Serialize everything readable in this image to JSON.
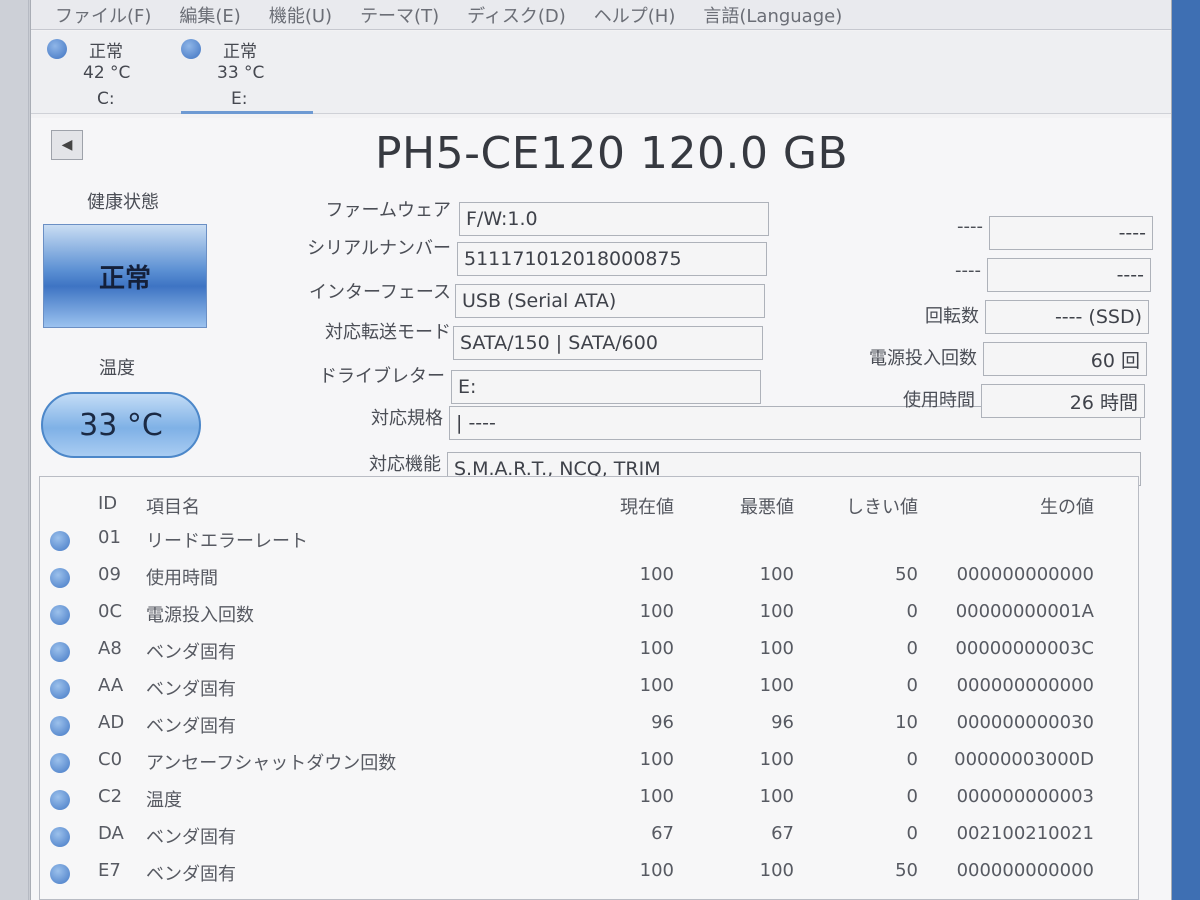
{
  "menu": [
    "ファイル(F)",
    "編集(E)",
    "機能(U)",
    "テーマ(T)",
    "ディスク(D)",
    "ヘルプ(H)",
    "言語(Language)"
  ],
  "drives": [
    {
      "status": "正常",
      "temp": "42 °C",
      "letter": "C:"
    },
    {
      "status": "正常",
      "temp": "33 °C",
      "letter": "E:"
    }
  ],
  "title": "PH5-CE120 120.0 GB",
  "nav": {
    "prev_glyph": "◀"
  },
  "health": {
    "label": "健康状態",
    "value": "正常"
  },
  "temperature": {
    "label": "温度",
    "value": "33 °C"
  },
  "info": {
    "firmware": {
      "label": "ファームウェア",
      "value": "F/W:1.0"
    },
    "serial": {
      "label": "シリアルナンバー",
      "value": "511171012018000875"
    },
    "interface": {
      "label": "インターフェース",
      "value": "USB (Serial ATA)"
    },
    "transfer": {
      "label": "対応転送モード",
      "value": "SATA/150 | SATA/600"
    },
    "drive_letter": {
      "label": "ドライブレター",
      "value": "E:"
    },
    "standard": {
      "label": "対応規格",
      "value": "| ----"
    },
    "features": {
      "label": "対応機能",
      "value": "S.M.A.R.T., NCQ, TRIM"
    }
  },
  "right_info": {
    "unknown1": {
      "label": "----",
      "value": "----"
    },
    "unknown2": {
      "label": "----",
      "value": "----"
    },
    "rotation": {
      "label": "回転数",
      "value": "---- (SSD)"
    },
    "power_count": {
      "label": "電源投入回数",
      "value": "60 回"
    },
    "hours": {
      "label": "使用時間",
      "value": "26 時間"
    }
  },
  "smart": {
    "headers": {
      "id": "ID",
      "name": "項目名",
      "current": "現在値",
      "worst": "最悪値",
      "threshold": "しきい値",
      "raw": "生の値"
    },
    "rows": [
      {
        "id": "01",
        "name": "リードエラーレート",
        "current": "",
        "worst": "",
        "threshold": "",
        "raw": ""
      },
      {
        "id": "09",
        "name": "使用時間",
        "current": "100",
        "worst": "100",
        "threshold": "50",
        "raw": "000000000000"
      },
      {
        "id": "0C",
        "name": "電源投入回数",
        "current": "100",
        "worst": "100",
        "threshold": "0",
        "raw": "00000000001A"
      },
      {
        "id": "A8",
        "name": "ベンダ固有",
        "current": "100",
        "worst": "100",
        "threshold": "0",
        "raw": "00000000003C"
      },
      {
        "id": "AA",
        "name": "ベンダ固有",
        "current": "100",
        "worst": "100",
        "threshold": "0",
        "raw": "000000000000"
      },
      {
        "id": "AD",
        "name": "ベンダ固有",
        "current": "96",
        "worst": "96",
        "threshold": "10",
        "raw": "000000000030"
      },
      {
        "id": "C0",
        "name": "アンセーフシャットダウン回数",
        "current": "100",
        "worst": "100",
        "threshold": "0",
        "raw": "00000003000D"
      },
      {
        "id": "C2",
        "name": "温度",
        "current": "100",
        "worst": "100",
        "threshold": "0",
        "raw": "000000000003"
      },
      {
        "id": "DA",
        "name": "ベンダ固有",
        "current": "67",
        "worst": "67",
        "threshold": "0",
        "raw": "002100210021"
      },
      {
        "id": "E7",
        "name": "ベンダ固有",
        "current": "100",
        "worst": "100",
        "threshold": "50",
        "raw": "000000000000"
      }
    ]
  }
}
